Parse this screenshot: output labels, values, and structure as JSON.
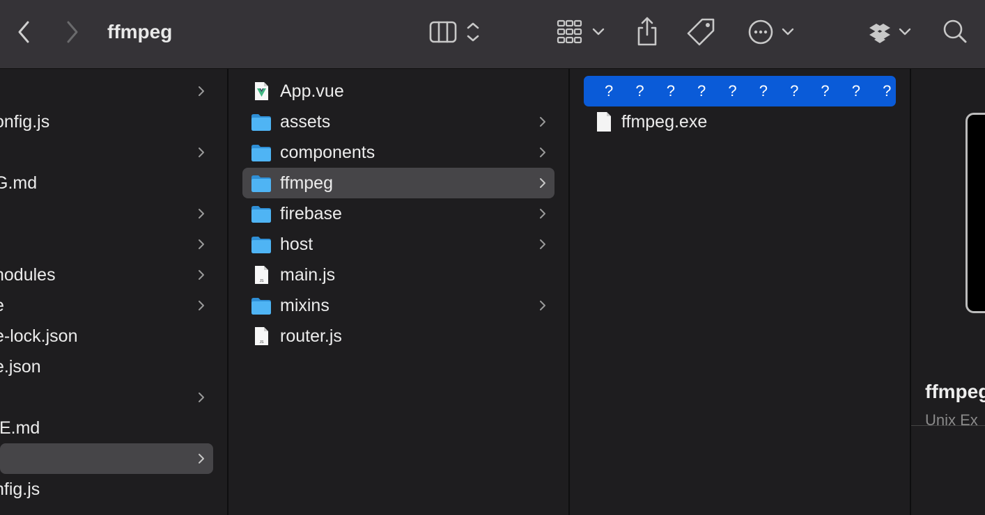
{
  "window": {
    "title": "ffmpeg"
  },
  "toolbar": {
    "back_icon": "chevron-left-icon",
    "forward_icon": "chevron-right-icon",
    "view_icon": "columns-view-icon",
    "group_icon": "grid-group-icon",
    "share_icon": "share-icon",
    "tag_icon": "tag-icon",
    "more_icon": "ellipsis-circle-icon",
    "dropbox_icon": "dropbox-icon",
    "search_icon": "search-icon"
  },
  "column1": {
    "items": [
      {
        "label": "",
        "has_arrow": true
      },
      {
        "label": "onfig.js",
        "has_arrow": false
      },
      {
        "label": "",
        "has_arrow": true
      },
      {
        "label": "G.md",
        "has_arrow": false
      },
      {
        "label": "",
        "has_arrow": true
      },
      {
        "label": "",
        "has_arrow": true
      },
      {
        "label": "nodules",
        "has_arrow": true
      },
      {
        "label": "e",
        "has_arrow": true
      },
      {
        "label": "e-lock.json",
        "has_arrow": false
      },
      {
        "label": "e.json",
        "has_arrow": false
      },
      {
        "label": "",
        "has_arrow": true
      },
      {
        "label": "IE.md",
        "has_arrow": false
      },
      {
        "label": "",
        "has_arrow": true,
        "selected": true
      },
      {
        "label": "nfig.js",
        "has_arrow": false
      }
    ]
  },
  "column2": {
    "items": [
      {
        "label": "App.vue",
        "type": "vue-file-icon",
        "has_arrow": false
      },
      {
        "label": "assets",
        "type": "folder-icon",
        "has_arrow": true
      },
      {
        "label": "components",
        "type": "folder-icon",
        "has_arrow": true
      },
      {
        "label": "ffmpeg",
        "type": "folder-icon",
        "has_arrow": true,
        "selected": true
      },
      {
        "label": "firebase",
        "type": "folder-icon",
        "has_arrow": true
      },
      {
        "label": "host",
        "type": "folder-icon",
        "has_arrow": true
      },
      {
        "label": "main.js",
        "type": "js-file-icon",
        "has_arrow": false
      },
      {
        "label": "mixins",
        "type": "folder-icon",
        "has_arrow": true
      },
      {
        "label": "router.js",
        "type": "js-file-icon",
        "has_arrow": false
      }
    ]
  },
  "column3": {
    "items": [
      {
        "label": "? ? ? ? ? ? ? ? ? ?",
        "type": "",
        "active": true
      },
      {
        "label": "ffmpeg.exe",
        "type": "blank-file-icon"
      }
    ]
  },
  "preview": {
    "name": "ffmpeg",
    "kind": "Unix Ex"
  },
  "colors": {
    "toolbar": "#353337",
    "background": "#1e1d1f",
    "selection_gray": "#464548",
    "selection_blue": "#0a5bd8",
    "folder_blue": "#3aa8f0"
  }
}
